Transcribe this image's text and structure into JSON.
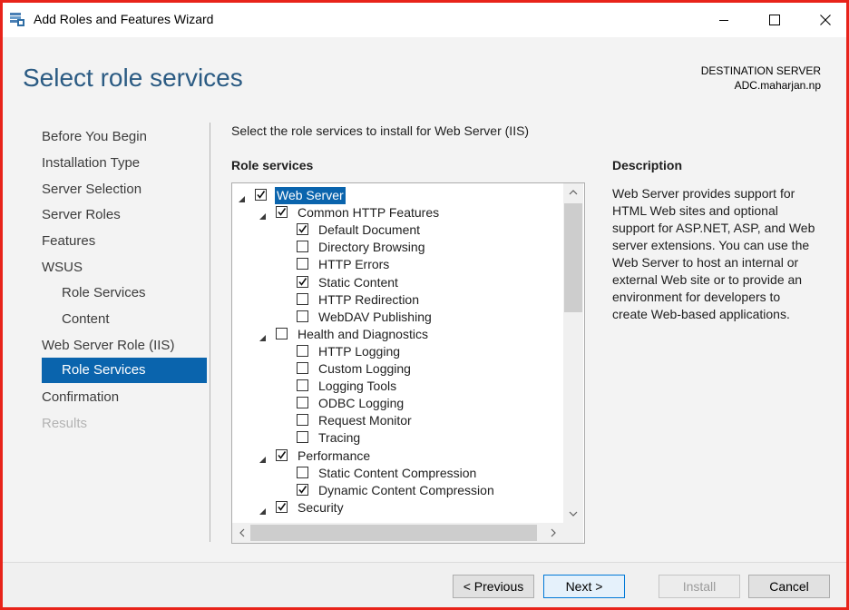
{
  "window": {
    "title": "Add Roles and Features Wizard",
    "icons": [
      "server-manager-icon",
      "minimize-icon",
      "maximize-icon",
      "close-icon"
    ]
  },
  "header": {
    "page_title": "Select role services",
    "destination_label": "DESTINATION SERVER",
    "destination_value": "ADC.maharjan.np"
  },
  "nav": {
    "items": [
      {
        "label": "Before You Begin",
        "state": "normal"
      },
      {
        "label": "Installation Type",
        "state": "normal"
      },
      {
        "label": "Server Selection",
        "state": "normal"
      },
      {
        "label": "Server Roles",
        "state": "normal"
      },
      {
        "label": "Features",
        "state": "normal"
      },
      {
        "label": "WSUS",
        "state": "normal"
      },
      {
        "label": "Role Services",
        "state": "sub"
      },
      {
        "label": "Content",
        "state": "sub"
      },
      {
        "label": "Web Server Role (IIS)",
        "state": "normal"
      },
      {
        "label": "Role Services",
        "state": "active"
      },
      {
        "label": "Confirmation",
        "state": "normal"
      },
      {
        "label": "Results",
        "state": "disabled"
      }
    ]
  },
  "main": {
    "intro": "Select the role services to install for Web Server (IIS)",
    "role_services_heading": "Role services",
    "tree": [
      {
        "label": "Web Server",
        "level": 0,
        "expanded": true,
        "checked": true,
        "selected": true
      },
      {
        "label": "Common HTTP Features",
        "level": 1,
        "expanded": true,
        "checked": true
      },
      {
        "label": "Default Document",
        "level": 2,
        "checked": true
      },
      {
        "label": "Directory Browsing",
        "level": 2,
        "checked": false
      },
      {
        "label": "HTTP Errors",
        "level": 2,
        "checked": false
      },
      {
        "label": "Static Content",
        "level": 2,
        "checked": true
      },
      {
        "label": "HTTP Redirection",
        "level": 2,
        "checked": false
      },
      {
        "label": "WebDAV Publishing",
        "level": 2,
        "checked": false
      },
      {
        "label": "Health and Diagnostics",
        "level": 1,
        "expanded": true,
        "checked": false
      },
      {
        "label": "HTTP Logging",
        "level": 2,
        "checked": false
      },
      {
        "label": "Custom Logging",
        "level": 2,
        "checked": false
      },
      {
        "label": "Logging Tools",
        "level": 2,
        "checked": false
      },
      {
        "label": "ODBC Logging",
        "level": 2,
        "checked": false
      },
      {
        "label": "Request Monitor",
        "level": 2,
        "checked": false
      },
      {
        "label": "Tracing",
        "level": 2,
        "checked": false
      },
      {
        "label": "Performance",
        "level": 1,
        "expanded": true,
        "checked": true
      },
      {
        "label": "Static Content Compression",
        "level": 2,
        "checked": false
      },
      {
        "label": "Dynamic Content Compression",
        "level": 2,
        "checked": true
      },
      {
        "label": "Security",
        "level": 1,
        "expanded": true,
        "checked": true
      }
    ]
  },
  "description": {
    "heading": "Description",
    "text": "Web Server provides support for HTML Web sites and optional support for ASP.NET, ASP, and Web server extensions. You can use the Web Server to host an internal or external Web site or to provide an environment for developers to create Web-based applications."
  },
  "footer": {
    "previous": "< Previous",
    "next": "Next >",
    "install": "Install",
    "cancel": "Cancel"
  },
  "colors": {
    "accent": "#0a64ad",
    "title": "#2b5b83",
    "frame_border": "#e8231a"
  }
}
